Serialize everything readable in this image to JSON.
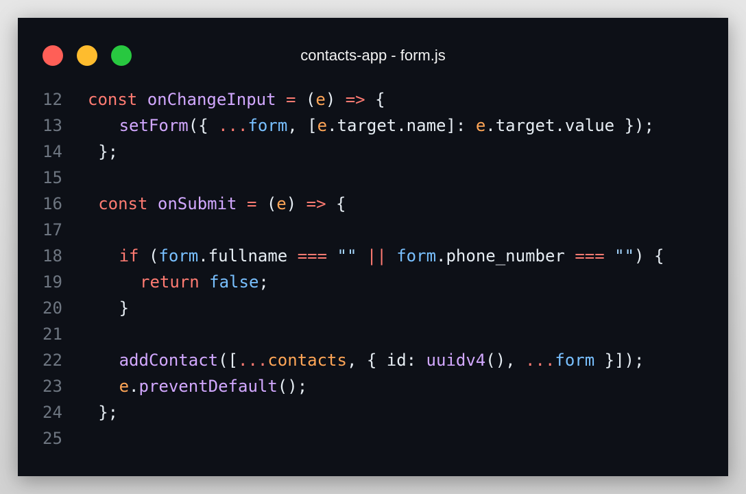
{
  "window": {
    "title": "contacts-app - form.js",
    "buttons": {
      "close_color": "#ff5f57",
      "minimize_color": "#febc2e",
      "zoom_color": "#28c840"
    }
  },
  "theme": {
    "background": "#0d1017",
    "line_number_color": "#6e7681",
    "keyword_color": "#ff7b72",
    "function_color": "#d2a8ff",
    "variable_color": "#79c0ff",
    "param_color": "#ffa657",
    "text_color": "#e6edf3"
  },
  "code": {
    "lines": [
      {
        "n": "12",
        "indent": 0,
        "tokens": [
          {
            "t": "const",
            "c": "kw"
          },
          {
            "t": " ",
            "c": "pl"
          },
          {
            "t": "onChangeInput",
            "c": "fn"
          },
          {
            "t": " ",
            "c": "pl"
          },
          {
            "t": "=",
            "c": "op"
          },
          {
            "t": " (",
            "c": "pl"
          },
          {
            "t": "e",
            "c": "prm"
          },
          {
            "t": ") ",
            "c": "pl"
          },
          {
            "t": "=>",
            "c": "op"
          },
          {
            "t": " {",
            "c": "pl"
          }
        ]
      },
      {
        "n": "13",
        "indent": 3,
        "tokens": [
          {
            "t": "setForm",
            "c": "fn"
          },
          {
            "t": "({ ",
            "c": "pl"
          },
          {
            "t": "...",
            "c": "op"
          },
          {
            "t": "form",
            "c": "var"
          },
          {
            "t": ", [",
            "c": "pl"
          },
          {
            "t": "e",
            "c": "prm"
          },
          {
            "t": ".target.name]: ",
            "c": "pl"
          },
          {
            "t": "e",
            "c": "prm"
          },
          {
            "t": ".target.value });",
            "c": "pl"
          }
        ]
      },
      {
        "n": "14",
        "indent": 1,
        "tokens": [
          {
            "t": "};",
            "c": "pl"
          }
        ]
      },
      {
        "n": "15",
        "indent": 0,
        "tokens": []
      },
      {
        "n": "16",
        "indent": 1,
        "tokens": [
          {
            "t": "const",
            "c": "kw"
          },
          {
            "t": " ",
            "c": "pl"
          },
          {
            "t": "onSubmit",
            "c": "fn"
          },
          {
            "t": " ",
            "c": "pl"
          },
          {
            "t": "=",
            "c": "op"
          },
          {
            "t": " (",
            "c": "pl"
          },
          {
            "t": "e",
            "c": "prm"
          },
          {
            "t": ") ",
            "c": "pl"
          },
          {
            "t": "=>",
            "c": "op"
          },
          {
            "t": " {",
            "c": "pl"
          }
        ]
      },
      {
        "n": "17",
        "indent": 0,
        "tokens": []
      },
      {
        "n": "18",
        "indent": 3,
        "tokens": [
          {
            "t": "if",
            "c": "kw"
          },
          {
            "t": " (",
            "c": "pl"
          },
          {
            "t": "form",
            "c": "var"
          },
          {
            "t": ".fullname ",
            "c": "pl"
          },
          {
            "t": "===",
            "c": "op"
          },
          {
            "t": " ",
            "c": "pl"
          },
          {
            "t": "\"\"",
            "c": "str"
          },
          {
            "t": " ",
            "c": "pl"
          },
          {
            "t": "||",
            "c": "op"
          },
          {
            "t": " ",
            "c": "pl"
          },
          {
            "t": "form",
            "c": "var"
          },
          {
            "t": ".phone_number ",
            "c": "pl"
          },
          {
            "t": "===",
            "c": "op"
          },
          {
            "t": " ",
            "c": "pl"
          },
          {
            "t": "\"\"",
            "c": "str"
          },
          {
            "t": ") {",
            "c": "pl"
          }
        ]
      },
      {
        "n": "19",
        "indent": 5,
        "tokens": [
          {
            "t": "return",
            "c": "kw"
          },
          {
            "t": " ",
            "c": "pl"
          },
          {
            "t": "false",
            "c": "var"
          },
          {
            "t": ";",
            "c": "pl"
          }
        ]
      },
      {
        "n": "20",
        "indent": 3,
        "tokens": [
          {
            "t": "}",
            "c": "pl"
          }
        ]
      },
      {
        "n": "21",
        "indent": 0,
        "tokens": []
      },
      {
        "n": "22",
        "indent": 3,
        "tokens": [
          {
            "t": "addContact",
            "c": "fn"
          },
          {
            "t": "([",
            "c": "pl"
          },
          {
            "t": "...",
            "c": "op"
          },
          {
            "t": "contacts",
            "c": "prm"
          },
          {
            "t": ", { id: ",
            "c": "pl"
          },
          {
            "t": "uuidv4",
            "c": "fn"
          },
          {
            "t": "(), ",
            "c": "pl"
          },
          {
            "t": "...",
            "c": "op"
          },
          {
            "t": "form",
            "c": "var"
          },
          {
            "t": " }]);",
            "c": "pl"
          }
        ]
      },
      {
        "n": "23",
        "indent": 3,
        "tokens": [
          {
            "t": "e",
            "c": "prm"
          },
          {
            "t": ".",
            "c": "pl"
          },
          {
            "t": "preventDefault",
            "c": "fn"
          },
          {
            "t": "();",
            "c": "pl"
          }
        ]
      },
      {
        "n": "24",
        "indent": 1,
        "tokens": [
          {
            "t": "};",
            "c": "pl"
          }
        ]
      },
      {
        "n": "25",
        "indent": 0,
        "tokens": []
      }
    ]
  }
}
